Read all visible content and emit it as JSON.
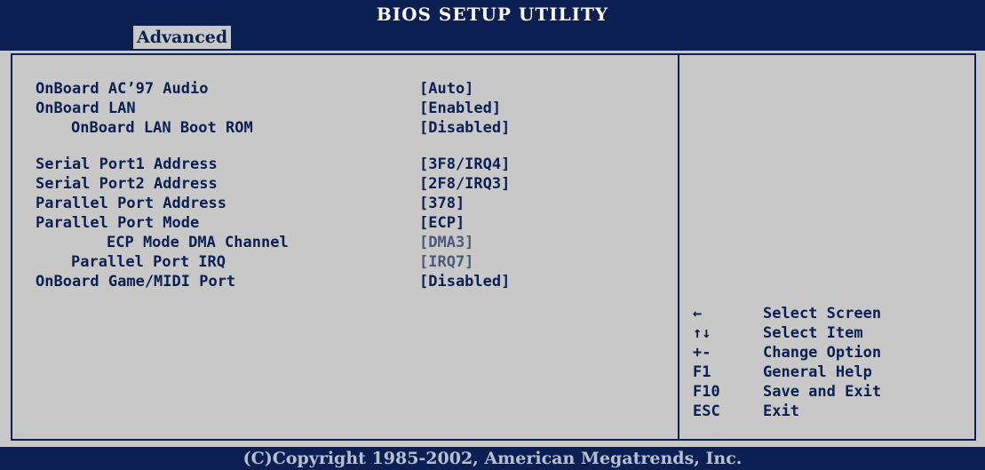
{
  "header": {
    "title": "BIOS SETUP UTILITY",
    "active_tab": "Advanced"
  },
  "settings": [
    {
      "label": "OnBoard AC’97 Audio",
      "value": "[Auto]",
      "indent": 0
    },
    {
      "label": "OnBoard LAN",
      "value": "[Enabled]",
      "indent": 0
    },
    {
      "label": "OnBoard LAN Boot ROM",
      "value": "[Disabled]",
      "indent": 1
    },
    {
      "label": "",
      "value": "",
      "indent": 0,
      "gap": true
    },
    {
      "label": "Serial Port1 Address",
      "value": "[3F8/IRQ4]",
      "indent": 0
    },
    {
      "label": "Serial Port2 Address",
      "value": "[2F8/IRQ3]",
      "indent": 0
    },
    {
      "label": "Parallel Port Address",
      "value": "[378]",
      "indent": 0
    },
    {
      "label": "Parallel Port Mode",
      "value": "[ECP]",
      "indent": 0
    },
    {
      "label": "ECP Mode DMA Channel",
      "value": "[DMA3]",
      "indent": 2,
      "dim": true
    },
    {
      "label": "Parallel Port IRQ",
      "value": "[IRQ7]",
      "indent": 3,
      "dim": true
    },
    {
      "label": "OnBoard Game/MIDI Port",
      "value": "[Disabled]",
      "indent": 0
    }
  ],
  "help": [
    {
      "key": "←",
      "desc": "Select Screen",
      "icon": "arrow-left-icon"
    },
    {
      "key": "↑↓",
      "desc": "Select Item",
      "icon": "arrow-up-down-icon"
    },
    {
      "key": "+-",
      "desc": "Change Option"
    },
    {
      "key": "F1",
      "desc": "General Help"
    },
    {
      "key": "F10",
      "desc": "Save and Exit"
    },
    {
      "key": "ESC",
      "desc": "Exit"
    }
  ],
  "footer": {
    "copyright": "(C)Copyright 1985-2002, American Megatrends, Inc."
  },
  "colors": {
    "bar": "#0b1f52",
    "panel": "#c8c8c8",
    "text": "#0b1f52",
    "dim_value": "#4a5a78"
  }
}
